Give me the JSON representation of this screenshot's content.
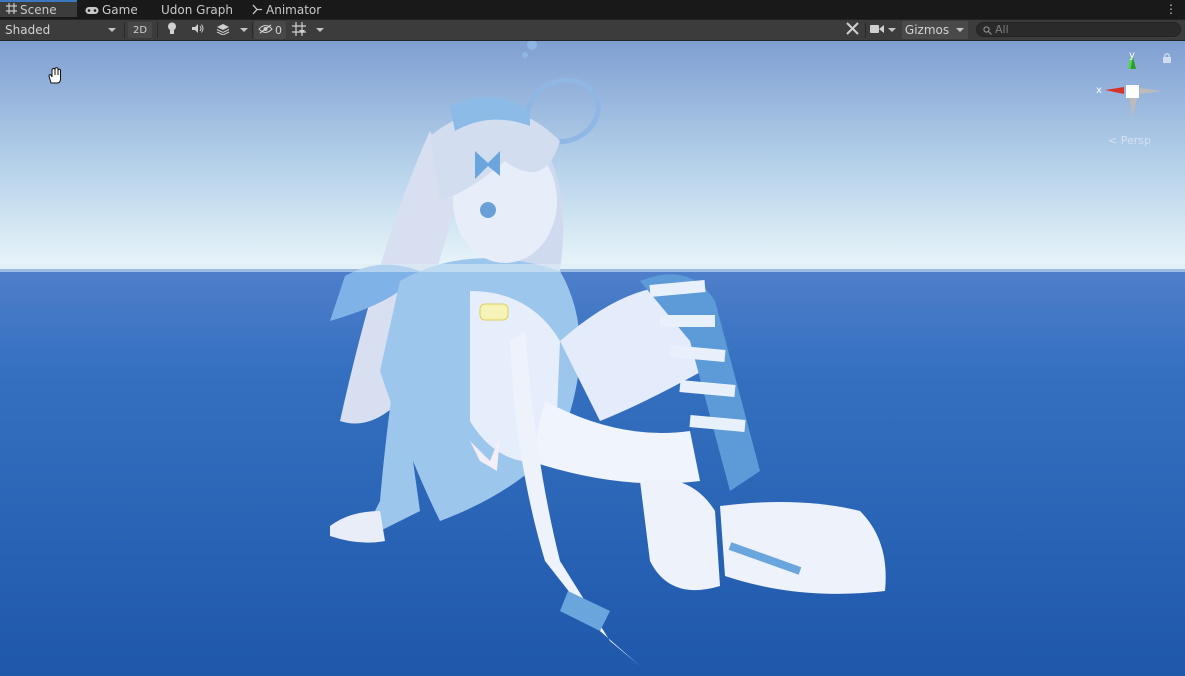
{
  "tabs": [
    {
      "label": "Scene",
      "icon": "grid-hash-icon",
      "active": true
    },
    {
      "label": "Game",
      "icon": "gamepad-icon",
      "active": false
    },
    {
      "label": "Udon Graph",
      "icon": "",
      "active": false
    },
    {
      "label": "Animator",
      "icon": "animator-node-icon",
      "active": false
    }
  ],
  "toolbar": {
    "shading_mode": "Shaded",
    "mode_2d": "2D",
    "hidden_count": "0",
    "gizmos_label": "Gizmos",
    "search_placeholder": "All"
  },
  "viewport": {
    "projection_label": "Persp",
    "axis_x_label": "x",
    "axis_y_label": "y",
    "sky_color": "#8ba8d6",
    "horizon_color": "#e8f4f9",
    "ground_color": "#2f6fc2"
  },
  "colors": {
    "accent": "#3a79bb",
    "toolbar_bg": "#3c3c3c"
  }
}
